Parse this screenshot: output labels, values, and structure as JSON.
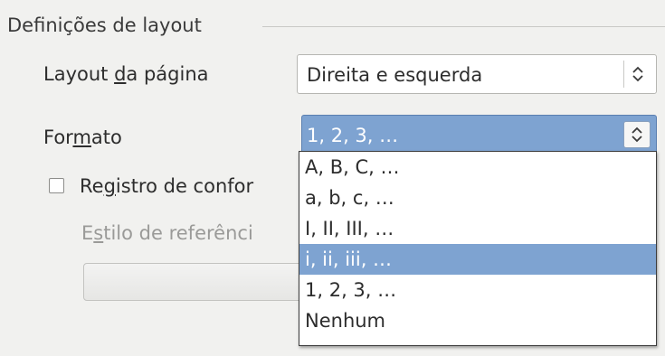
{
  "section": {
    "title": "Definições de layout"
  },
  "page_layout": {
    "label_pre": "Layout ",
    "label_mnemonic": "d",
    "label_post": "a página",
    "value": "Direita e esquerda",
    "spin_icon": "up-down-arrows-icon"
  },
  "format": {
    "label_pre": "For",
    "label_mnemonic": "m",
    "label_post": "ato",
    "value": "1, 2, 3, …",
    "spin_icon": "up-down-arrows-icon",
    "options": [
      "A, B, C, …",
      "a, b, c, …",
      "I, II, III, …",
      "i, ii, iii, …",
      "1, 2, 3, …",
      "Nenhum"
    ],
    "highlighted_option": "i, ii, iii, …"
  },
  "register_true": {
    "label_pre": "Re",
    "label_mnemonic": "g",
    "label_post": "istro de confor",
    "checked": false
  },
  "reference_style": {
    "label_pre": "E",
    "label_mnemonic": "s",
    "label_post": "tilo de referênci",
    "value": ""
  },
  "colors": {
    "background": "#f1f1ef",
    "selection": "#7ea3d1"
  }
}
